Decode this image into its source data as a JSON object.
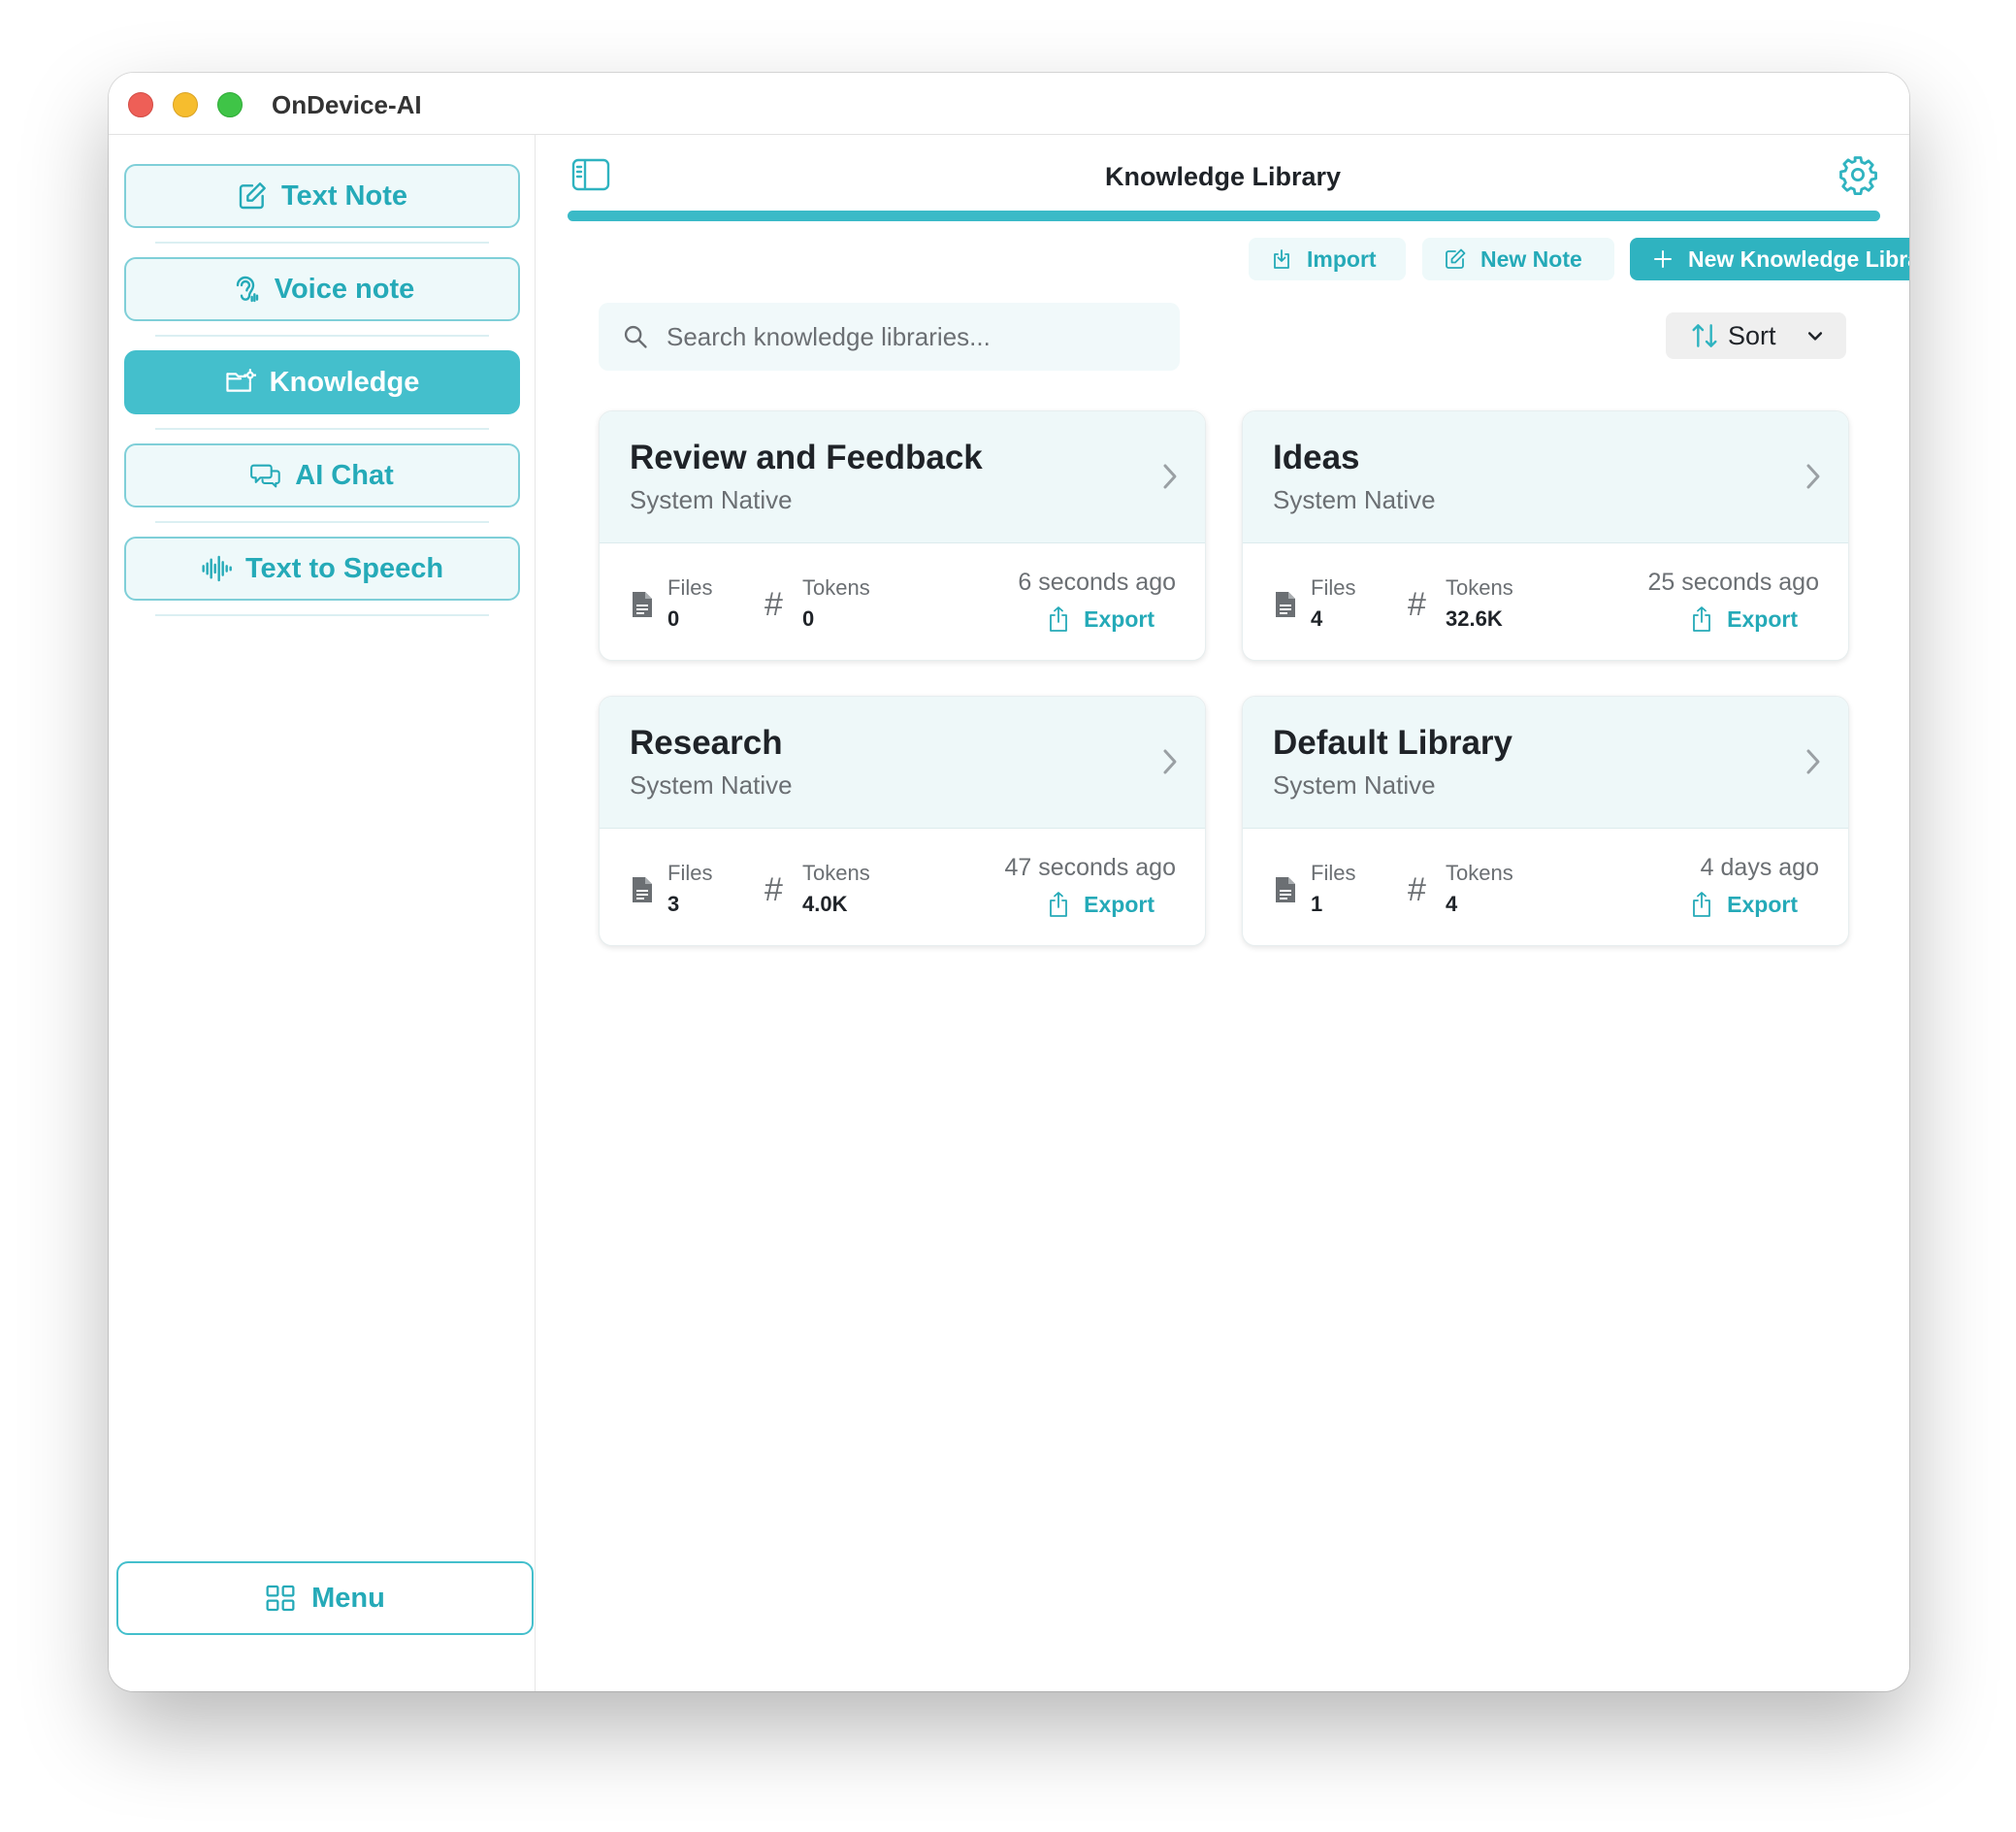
{
  "app": {
    "title": "OnDevice-AI"
  },
  "sidebar": {
    "items": [
      {
        "label": "Text Note",
        "icon": "edit-icon",
        "active": false
      },
      {
        "label": "Voice note",
        "icon": "hearing-icon",
        "active": false
      },
      {
        "label": "Knowledge",
        "icon": "folder-settings-icon",
        "active": true
      },
      {
        "label": "AI Chat",
        "icon": "chat-bubbles-icon",
        "active": false
      },
      {
        "label": "Text to Speech",
        "icon": "waveform-icon",
        "active": false
      }
    ],
    "menu_label": "Menu"
  },
  "header": {
    "title": "Knowledge Library",
    "progress": 1.0
  },
  "toolbar": {
    "import_label": "Import",
    "new_note_label": "New Note",
    "new_library_label": "New Knowledge Library"
  },
  "search": {
    "placeholder": "Search knowledge libraries...",
    "value": ""
  },
  "sort": {
    "label": "Sort"
  },
  "libraries": [
    {
      "name": "Review and Feedback",
      "source": "System Native",
      "files_label": "Files",
      "files": "0",
      "tokens_label": "Tokens",
      "tokens": "0",
      "updated": "6 seconds ago",
      "export_label": "Export"
    },
    {
      "name": "Ideas",
      "source": "System Native",
      "files_label": "Files",
      "files": "4",
      "tokens_label": "Tokens",
      "tokens": "32.6K",
      "updated": "25 seconds ago",
      "export_label": "Export"
    },
    {
      "name": "Research",
      "source": "System Native",
      "files_label": "Files",
      "files": "3",
      "tokens_label": "Tokens",
      "tokens": "4.0K",
      "updated": "47 seconds ago",
      "export_label": "Export"
    },
    {
      "name": "Default Library",
      "source": "System Native",
      "files_label": "Files",
      "files": "1",
      "tokens_label": "Tokens",
      "tokens": "4",
      "updated": "4 days ago",
      "export_label": "Export"
    }
  ],
  "colors": {
    "accent": "#2fb3c0",
    "accent_text": "#25aab8",
    "active_nav": "#44bfcc",
    "card_head": "#eef8f9"
  }
}
